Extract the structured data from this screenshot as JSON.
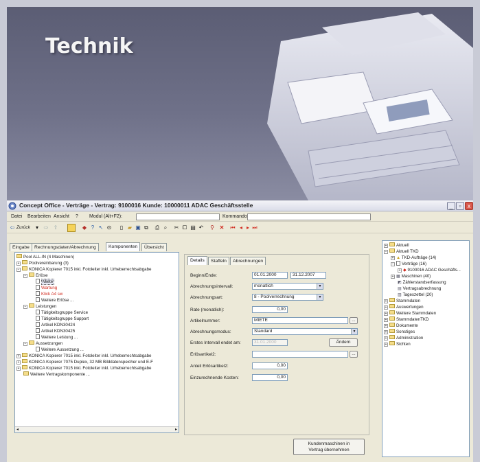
{
  "banner": {
    "title": "Technik"
  },
  "window": {
    "title": "Concept Office - Verträge - Vertrag: 9100016  Kunde: 10000011 ADAC Geschäftsstelle",
    "minimize": "_",
    "maximize": "▫",
    "close": "x"
  },
  "menu": {
    "items": [
      "Datei",
      "Bearbeiten",
      "Ansicht",
      "?",
      "Modul (Alt+F2):"
    ],
    "kommando_label": "Kommando:"
  },
  "toolbar": {
    "back_label": "Zurück"
  },
  "tabs": [
    "Eingabe",
    "Rechnungsdaten/Abrechnung",
    "Komponenten",
    "Übersicht"
  ],
  "tree": [
    "Pool ALL-IN (4 Maschinen)",
    "Poolvereinbarung (3)",
    "KONICA Kopierer 7015 inkl. Fotoleiter inkl. Urheberrechtsabgabe",
    "Erlöse",
    "Miete",
    "Wartung",
    "Klick A4 sw",
    "Weitere Erlöse ...",
    "Leistungen",
    "Tätigkeitsgruppe Service",
    "Tätigkeitsgruppe Support",
    "Artikel KDN30424",
    "Artikel KDN30425",
    "Weitere Leistung ...",
    "Aussetzungen",
    "Weitere Aussetzung ...",
    "KONICA Kopierer 7015 inkl. Fotoleiter inkl. Urheberrechtsabgabe",
    "KONICA Kopierer 7075 Duplex, 32 MB Bilddatenspeicher und E-F",
    "KONICA Kopierer 7015 inkl. Fotoleiter inkl. Urheberrechtsabgabe",
    "Weitere Vertragskomponente ..."
  ],
  "detail": {
    "tabs": [
      "Details",
      "Staffeln",
      "Abrechnungen"
    ],
    "labels": {
      "beginn": "Beginn/Ende:",
      "intervall": "Abrechnungsintervall:",
      "art": "Abrechnungsart:",
      "rate": "Rate (monatlich):",
      "artikel": "Artikelnummer:",
      "modus": "Abrechnungsmodus:",
      "erstes": "Erstes Intervall endet am:",
      "erloes2": "Erlösartikel2:",
      "anteil": "Anteil Erlösartikel2:",
      "kosten": "Einzurechnende Kosten:"
    },
    "values": {
      "beginn": "01.01.2000",
      "ende": "31.12.2007",
      "intervall": "monatlich",
      "art": "8 - Poolverrechnung",
      "rate": "0,00",
      "artikel": "MIETE",
      "modus": "Standard",
      "erstes": "31.01.2000",
      "erloes2": "",
      "anteil": "0,00",
      "kosten": "0,00"
    },
    "aendern": "Ändern",
    "browse": "..."
  },
  "button_take": [
    "Kundenmaschinen in",
    "Vertrag übernehmen"
  ],
  "side_tree": [
    "Aktuell",
    "Aktuell TKD",
    "TKD-Aufträge (14)",
    "Verträge (16)",
    "9100016 ADAC Geschäfts...",
    "Maschinen (40)",
    "Zählerstandserfassung",
    "Vertragsabrechnung",
    "Tageszettel (20)",
    "Stammdaten",
    "Auswertungen",
    "Weitere Stammdaten",
    "StammdatenTKD",
    "Dokumente",
    "Sonstiges",
    "Administration",
    "Sichten"
  ],
  "colors": {
    "accent_red": "#d12a1e",
    "banner": "#6f7189",
    "window_bg": "#ece9d8"
  }
}
